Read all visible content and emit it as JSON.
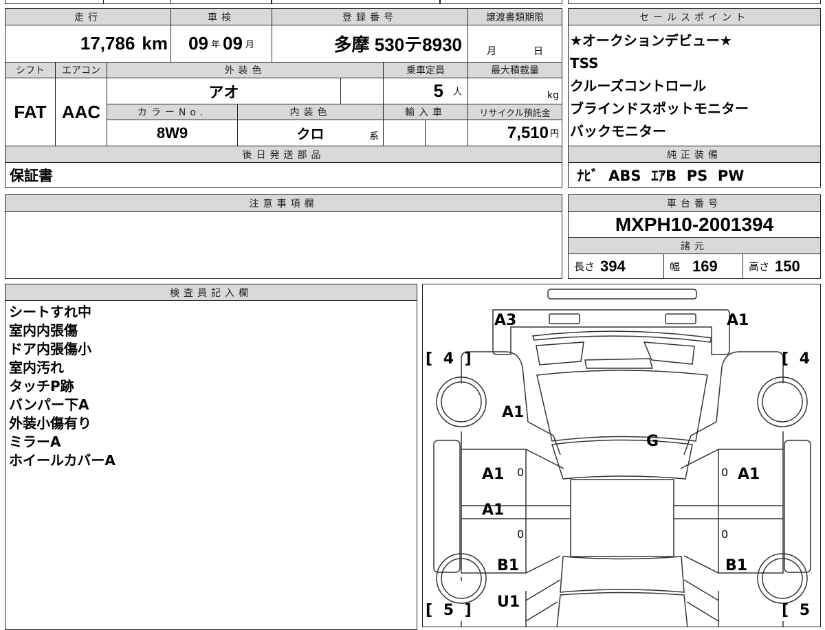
{
  "main": {
    "mileage": {
      "label": "走行",
      "value": "17,786",
      "unit": "km"
    },
    "inspection": {
      "label": "車検",
      "year": "09",
      "year_unit": "年",
      "month": "09",
      "month_unit": "月"
    },
    "registration": {
      "label": "登録番号",
      "value": "多摩 530テ8930"
    },
    "transfer_deadline": {
      "label": "譲渡書類期限",
      "month_unit": "月",
      "day_unit": "日"
    },
    "shift": {
      "label": "シフト",
      "value": "FAT"
    },
    "aircon": {
      "label": "エアコン",
      "value": "AAC"
    },
    "exterior_color": {
      "label": "外装色",
      "value": "アオ"
    },
    "capacity": {
      "label": "乗車定員",
      "value": "5",
      "unit": "人"
    },
    "max_load": {
      "label": "最大積載量",
      "unit": "kg"
    },
    "color_no": {
      "label": "カラーNo.",
      "value": "8W9"
    },
    "interior_color": {
      "label": "内装色",
      "value": "クロ",
      "suffix": "系"
    },
    "import": {
      "label": "輸入車"
    },
    "recycle": {
      "label": "リサイクル預託金",
      "value": "7,510",
      "unit": "円"
    },
    "later_parts": {
      "label": "後日発送部品",
      "value": "保証書"
    }
  },
  "sales_points": {
    "label": "セールスポイント",
    "items": [
      "★オークションデビュー★",
      "TSS",
      "クルーズコントロール",
      "ブラインドスポットモニター",
      "バックモニター"
    ]
  },
  "equipment": {
    "label": "純正装備",
    "value": "ﾅﾋﾞ  ABS  ｴｱB  PS  PW"
  },
  "notes": {
    "label": "注意事項欄"
  },
  "chassis": {
    "label": "車台番号",
    "value": "MXPH10-2001394"
  },
  "specs": {
    "label": "諸元",
    "length_label": "長さ",
    "length": "394",
    "width_label": "幅",
    "width": "169",
    "height_label": "高さ",
    "height": "150"
  },
  "inspector": {
    "label": "検査員記入欄",
    "items": [
      "シートすれ中",
      "室内内張傷",
      "ドア内張傷小",
      "室内汚れ",
      "タッチP跡",
      "バンパー下A",
      "外装小傷有り",
      "ミラーA",
      "ホイールカバーA"
    ]
  },
  "diagram": {
    "rear_left": "A3",
    "rear_right": "A1",
    "tread_front_left": "[ 4 ]",
    "tread_front_right": "[ 4 ]",
    "tread_rear_left": "[ 5 ]",
    "tread_rear_right": "[ 5 ]",
    "left_quarter": "A1",
    "glass": "G",
    "left_rear_door": "A1",
    "left_front_door": "A1",
    "right_rear_door": "A1",
    "left_fender": "B1",
    "right_fender": "B1",
    "front_bumper_left": "U1",
    "zero": "0"
  }
}
